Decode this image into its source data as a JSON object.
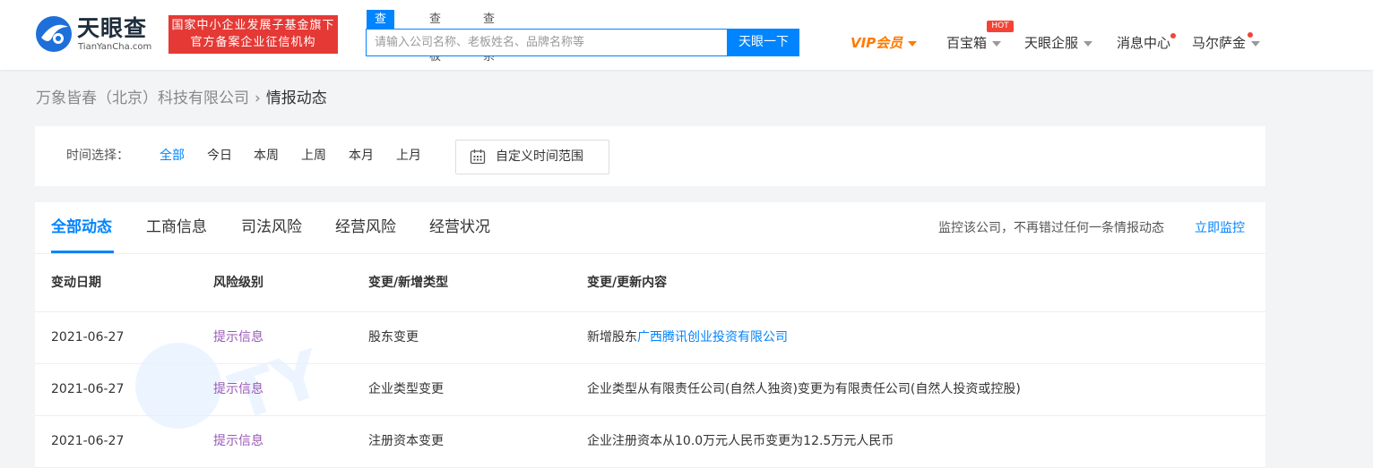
{
  "header": {
    "logo": {
      "cn": "天眼查",
      "en": "TianYanCha.com"
    },
    "slogan": {
      "line1": "国家中小企业发展子基金旗下",
      "line2": "官方备案企业征信机构"
    },
    "search_tabs": [
      "查公司",
      "查老板",
      "查关系"
    ],
    "search": {
      "placeholder": "请输入公司名称、老板姓名、品牌名称等",
      "value": ""
    },
    "search_button": "天眼一下",
    "nav": {
      "vip": "VIP会员",
      "treasure": "百宝箱",
      "hot": "HOT",
      "enterprise": "天眼企服",
      "messages": "消息中心",
      "user": "马尔萨金"
    }
  },
  "breadcrumb": {
    "company": "万象皆春（北京）科技有限公司",
    "current": "情报动态"
  },
  "filter": {
    "label": "时间选择：",
    "options": [
      "全部",
      "今日",
      "本周",
      "上周",
      "本月",
      "上月"
    ],
    "active": "全部",
    "custom_range": "自定义时间范围"
  },
  "tabs": [
    "全部动态",
    "工商信息",
    "司法风险",
    "经营风险",
    "经营状况"
  ],
  "monitor": {
    "text": "监控该公司，不再错过任何一条情报动态",
    "link": "立即监控"
  },
  "table": {
    "headers": [
      "变动日期",
      "风险级别",
      "变更/新增类型",
      "变更/更新内容"
    ],
    "rows": [
      {
        "date": "2021-06-27",
        "risk": "提示信息",
        "type": "股东变更",
        "content_prefix": "新增股东",
        "content_link": "广西腾讯创业投资有限公司"
      },
      {
        "date": "2021-06-27",
        "risk": "提示信息",
        "type": "企业类型变更",
        "content_prefix": "企业类型从有限责任公司(自然人独资)变更为有限责任公司(自然人投资或控股)",
        "content_link": ""
      },
      {
        "date": "2021-06-27",
        "risk": "提示信息",
        "type": "注册资本变更",
        "content_prefix": "企业注册资本从10.0万元人民币变更为12.5万元人民币",
        "content_link": ""
      }
    ]
  },
  "colors": {
    "accent": "#0084ff",
    "brand_red": "#e53935",
    "vip": "#ff7a00",
    "risk_info": "#9b59b6"
  },
  "icons": {
    "logo": "tianyancha-logo-icon",
    "calendar": "calendar-icon",
    "caret": "caret-down-icon"
  }
}
